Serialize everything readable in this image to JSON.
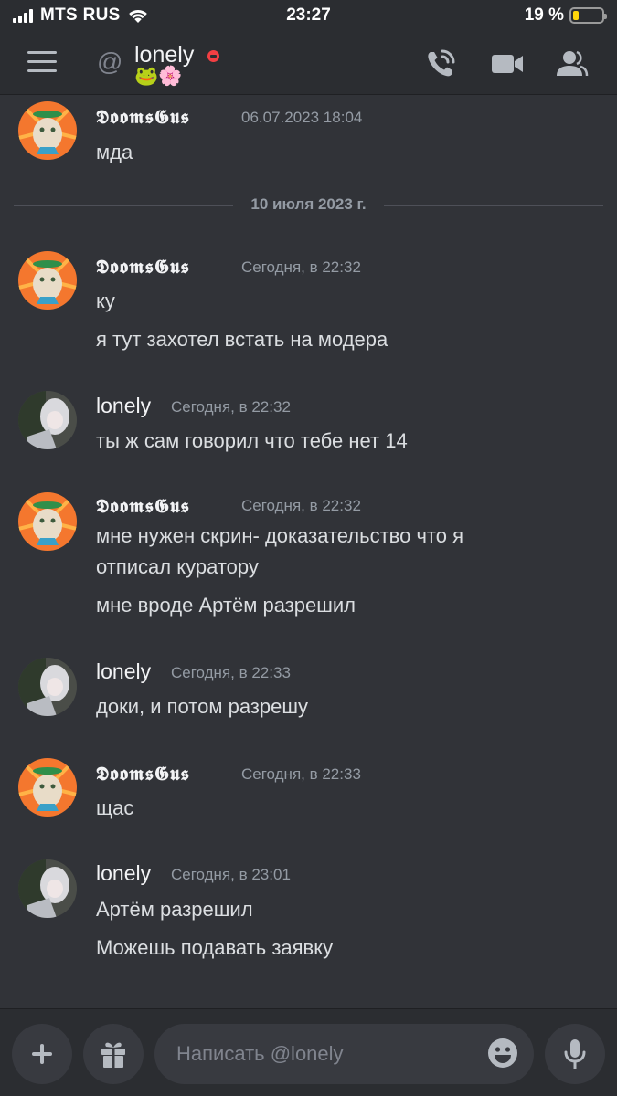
{
  "status_bar": {
    "carrier": "MTS RUS",
    "time": "23:27",
    "battery_text": "19 %",
    "battery_level": 0.19,
    "battery_color": "#ffd60a"
  },
  "header": {
    "at_symbol": "@",
    "username": "lonely",
    "custom_status": "🐸🌸",
    "presence": "dnd",
    "icons": [
      "menu-icon",
      "at-icon",
      "call-icon",
      "video-icon",
      "members-icon"
    ]
  },
  "messages": [
    {
      "author": "𝕯𝖔𝖔𝖒𝖘𝕲𝖚𝖘",
      "timestamp": "06.07.2023 18:04",
      "lines": [
        "мда"
      ]
    },
    {
      "author": "𝕯𝖔𝖔𝖒𝖘𝕲𝖚𝖘",
      "timestamp": "Сегодня, в 22:32",
      "lines": [
        "ку",
        "я тут захотел встать на модера"
      ]
    },
    {
      "author": "lonely",
      "timestamp": "Сегодня, в 22:32",
      "lines": [
        "ты ж сам говорил что тебе нет 14"
      ]
    },
    {
      "author": "𝕯𝖔𝖔𝖒𝖘𝕲𝖚𝖘",
      "timestamp": "Сегодня, в 22:32",
      "lines": [
        "мне нужен скрин- доказательство что я",
        "отписал куратору",
        "мне вроде Артём разрешил"
      ]
    },
    {
      "author": "lonely",
      "timestamp": "Сегодня, в 22:33",
      "lines": [
        "доки, и потом разрешу"
      ]
    },
    {
      "author": "𝕯𝖔𝖔𝖒𝖘𝕲𝖚𝖘",
      "timestamp": "Сегодня, в 22:33",
      "lines": [
        "щас"
      ]
    },
    {
      "author": "lonely",
      "timestamp": "Сегодня, в 23:01",
      "lines": [
        "Артём разрешил",
        "Можешь подавать заявку"
      ]
    }
  ],
  "date_divider": "10 июля 2023 г.",
  "composer": {
    "placeholder": "Написать @lonely",
    "icons": [
      "plus-icon",
      "gift-icon",
      "emoji-icon",
      "mic-icon"
    ]
  },
  "colors": {
    "background": "#313338",
    "header": "#2b2d31",
    "dnd": "#f23f43",
    "text": "#dbdee1",
    "muted": "#949ba4"
  }
}
